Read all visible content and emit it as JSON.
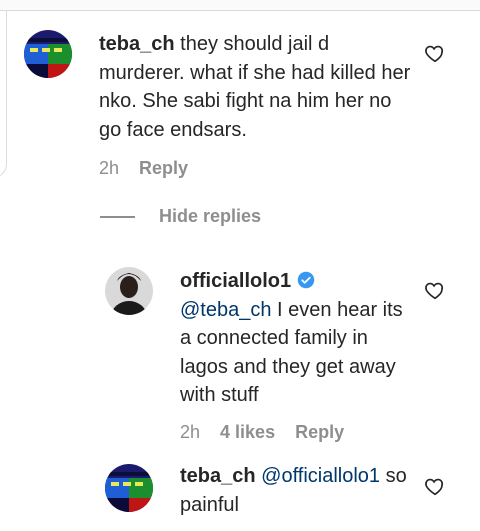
{
  "comment": {
    "username": "teba_ch",
    "text": "they should jail d murderer. what if she had killed her nko. She sabi fight na him her no go face endsars.",
    "time": "2h",
    "reply_label": "Reply"
  },
  "hide_replies_label": "Hide replies",
  "replies": [
    {
      "username": "officiallolo1",
      "verified": true,
      "mention": "@teba_ch",
      "text": "I even hear its a connected family in lagos and they get away with stuff",
      "time": "2h",
      "likes": "4 likes",
      "reply_label": "Reply"
    },
    {
      "username": "teba_ch",
      "mention": "@officiallolo1",
      "text": "so painful"
    }
  ],
  "colors": {
    "verified_blue": "#3897f0",
    "mention": "#00376b",
    "meta": "#8e8e8e"
  }
}
